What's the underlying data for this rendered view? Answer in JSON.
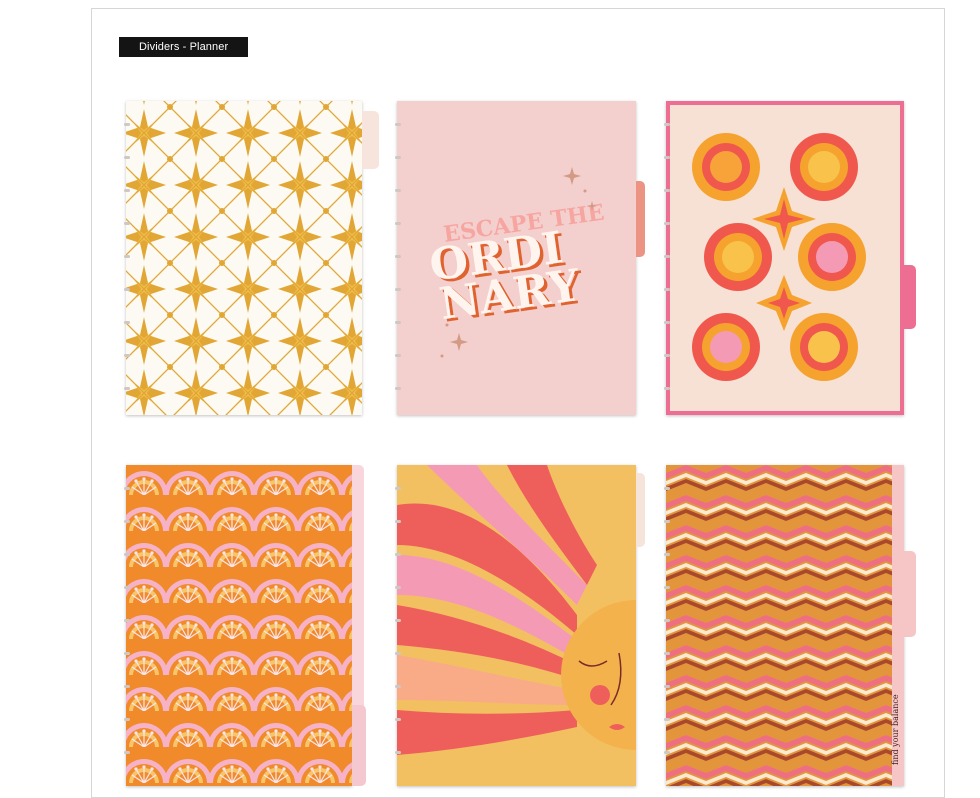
{
  "section": {
    "label": "Dividers - Planner"
  },
  "dividers": [
    {
      "name": "Gold star tile",
      "tab_color": "#f7e4dc",
      "base_color": "#fdfaf3",
      "accent": "#e2a634"
    },
    {
      "name": "Escape the ordinary",
      "tab_color": "#ec9383",
      "base_color": "#f3cfcd",
      "quote_line1": "ESCAPE THE",
      "quote_line2": "ORDI",
      "quote_line3": "NARY"
    },
    {
      "name": "Sun faces",
      "tab_color": "#ee6d93",
      "base_color": "#f7e0d4",
      "accent": "#f0584d"
    },
    {
      "name": "Rainbow scallops",
      "tab_color": "#f5c7cf",
      "base_color": "#f08a2a",
      "accent": "#f6b2c6"
    },
    {
      "name": "Sun rays face",
      "tab_color": "#f6e3da",
      "base_color": "#f3c061",
      "accent": "#ee5f5c"
    },
    {
      "name": "Ikat chevron",
      "tab_color": "#f6c6c6",
      "base_color": "#e3953b",
      "accent": "#ee6f82",
      "script_text": "find your balance"
    }
  ]
}
